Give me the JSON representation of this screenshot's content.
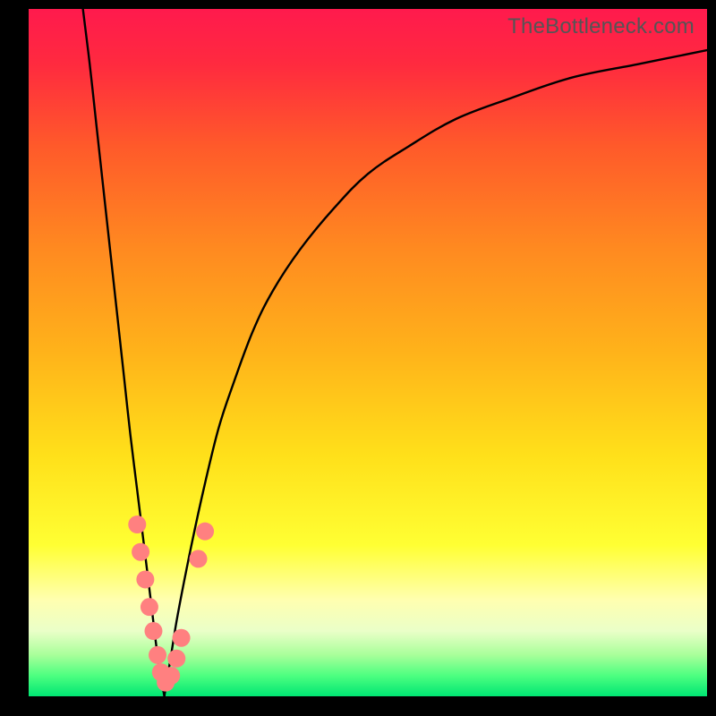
{
  "watermark": "TheBottleneck.com",
  "frame": {
    "outer_size": 800,
    "border_left": 32,
    "border_right": 10,
    "border_top": 10,
    "border_bottom": 22,
    "border_color": "#000000"
  },
  "gradient_stops": [
    {
      "offset": 0.0,
      "color": "#ff1a4d"
    },
    {
      "offset": 0.08,
      "color": "#ff2a3f"
    },
    {
      "offset": 0.2,
      "color": "#ff5a2a"
    },
    {
      "offset": 0.35,
      "color": "#ff8a20"
    },
    {
      "offset": 0.5,
      "color": "#ffb31a"
    },
    {
      "offset": 0.65,
      "color": "#ffe01a"
    },
    {
      "offset": 0.78,
      "color": "#ffff33"
    },
    {
      "offset": 0.86,
      "color": "#ffffb0"
    },
    {
      "offset": 0.905,
      "color": "#eaffc8"
    },
    {
      "offset": 0.94,
      "color": "#a8ff9a"
    },
    {
      "offset": 0.97,
      "color": "#4dff80"
    },
    {
      "offset": 1.0,
      "color": "#00e673"
    }
  ],
  "chart_data": {
    "type": "line",
    "title": "",
    "xlabel": "",
    "ylabel": "",
    "x_range": [
      0,
      100
    ],
    "y_range": [
      0,
      100
    ],
    "notch_x": 20,
    "series": [
      {
        "name": "left-branch",
        "style": "line",
        "color": "#000000",
        "x": [
          8,
          9,
          10,
          11,
          12,
          13,
          14,
          15,
          16,
          17,
          18,
          19,
          20
        ],
        "y": [
          100,
          92,
          83,
          74,
          65,
          56,
          47,
          38,
          30,
          22,
          14,
          6,
          0
        ]
      },
      {
        "name": "right-branch",
        "style": "line",
        "color": "#000000",
        "x": [
          20,
          21,
          22,
          24,
          26,
          28,
          30,
          33,
          36,
          40,
          45,
          50,
          56,
          63,
          71,
          80,
          90,
          100
        ],
        "y": [
          0,
          6,
          12,
          22,
          31,
          39,
          45,
          53,
          59,
          65,
          71,
          76,
          80,
          84,
          87,
          90,
          92,
          94
        ]
      },
      {
        "name": "markers",
        "style": "scatter",
        "color": "#ff8080",
        "radius": 10,
        "points": [
          {
            "x": 16.0,
            "y": 25.0
          },
          {
            "x": 16.5,
            "y": 21.0
          },
          {
            "x": 17.2,
            "y": 17.0
          },
          {
            "x": 17.8,
            "y": 13.0
          },
          {
            "x": 18.4,
            "y": 9.5
          },
          {
            "x": 19.0,
            "y": 6.0
          },
          {
            "x": 19.5,
            "y": 3.5
          },
          {
            "x": 20.2,
            "y": 2.0
          },
          {
            "x": 21.0,
            "y": 3.0
          },
          {
            "x": 21.8,
            "y": 5.5
          },
          {
            "x": 22.5,
            "y": 8.5
          },
          {
            "x": 25.0,
            "y": 20.0
          },
          {
            "x": 26.0,
            "y": 24.0
          }
        ]
      }
    ]
  }
}
